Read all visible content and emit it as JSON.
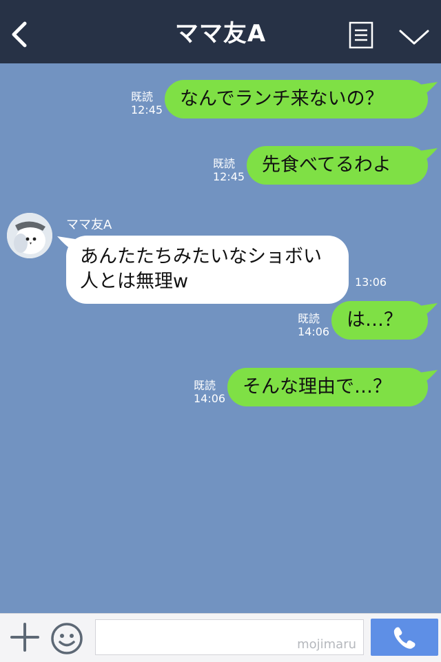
{
  "header": {
    "title": "ママ友A"
  },
  "messages": [
    {
      "read": "既読",
      "time": "12:45",
      "text": "なんでランチ来ないの？"
    },
    {
      "read": "既読",
      "time": "12:45",
      "text": "先食べてるわよ"
    },
    {
      "sender": "ママ友A",
      "text": "あんたたちみたいなショボい人とは無理w",
      "time": "13:06"
    },
    {
      "read": "既読",
      "time": "14:06",
      "text": "は…？"
    },
    {
      "read": "既読",
      "time": "14:06",
      "text": "そんな理由で…？"
    }
  ],
  "bottom": {
    "watermark": "mojimaru"
  },
  "colors": {
    "background": "#7293c1",
    "header": "#273246",
    "outgoing_bubble": "#7fe045",
    "incoming_bubble": "#ffffff",
    "call_button": "#5e8fe6"
  },
  "icons": [
    "back-arrow-icon",
    "menu-list-icon",
    "chevron-down-icon",
    "plus-icon",
    "emoji-icon",
    "phone-icon"
  ]
}
